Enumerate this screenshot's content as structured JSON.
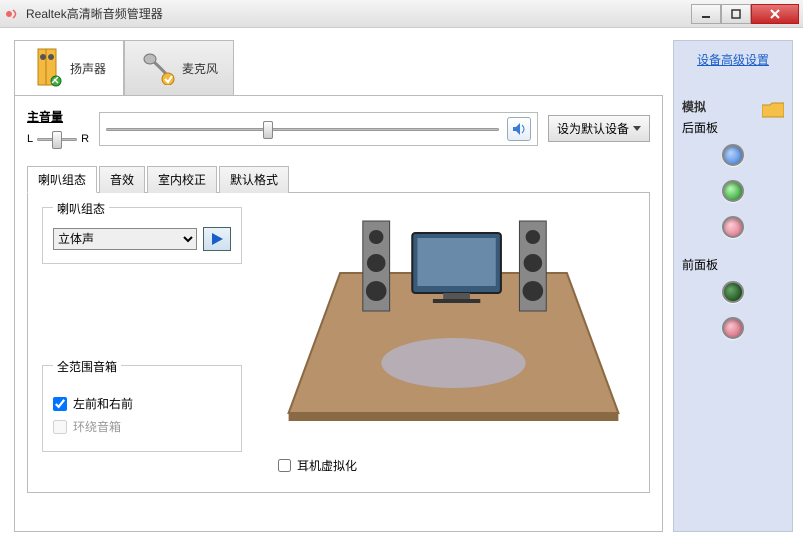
{
  "window": {
    "title": "Realtek高清晰音频管理器"
  },
  "deviceTabs": {
    "speaker": "扬声器",
    "mic": "麦克风"
  },
  "volume": {
    "label": "主音量",
    "left": "L",
    "right": "R",
    "defaultBtn": "设为默认设备"
  },
  "subtabs": {
    "config": "喇叭组态",
    "effects": "音效",
    "room": "室内校正",
    "format": "默认格式"
  },
  "speakerConfig": {
    "groupTitle": "喇叭组态",
    "selected": "立体声"
  },
  "fullRange": {
    "groupTitle": "全范围音箱",
    "frontLR": "左前和右前",
    "surround": "环绕音箱"
  },
  "headphoneVirt": "耳机虚拟化",
  "rightPanel": {
    "advanced": "设备高级设置",
    "analog": "模拟",
    "backPanel": "后面板",
    "frontPanel": "前面板"
  }
}
